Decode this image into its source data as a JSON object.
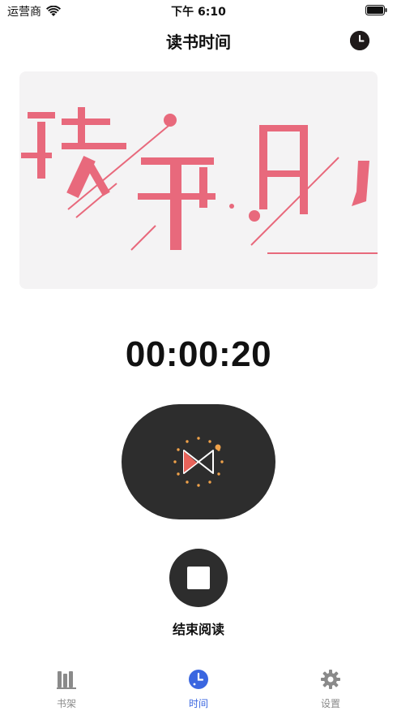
{
  "status_bar": {
    "carrier": "运营商",
    "time": "下午 6:10"
  },
  "nav": {
    "title": "读书时间",
    "history_icon": "clock-icon"
  },
  "banner": {
    "characters": [
      "读",
      "书",
      "日",
      ","
    ],
    "accent_color": "#e8697c"
  },
  "timer": {
    "value": "00:00:20"
  },
  "actions": {
    "stop_label": "结束阅读"
  },
  "tabs": [
    {
      "label": "书架",
      "icon": "bookshelf-icon",
      "active": false
    },
    {
      "label": "时间",
      "icon": "clock-icon",
      "active": true
    },
    {
      "label": "设置",
      "icon": "gear-icon",
      "active": false
    }
  ],
  "colors": {
    "active_tab": "#3a66e0",
    "inactive_tab": "#8a8a8a",
    "dark_button": "#2d2d2d"
  }
}
